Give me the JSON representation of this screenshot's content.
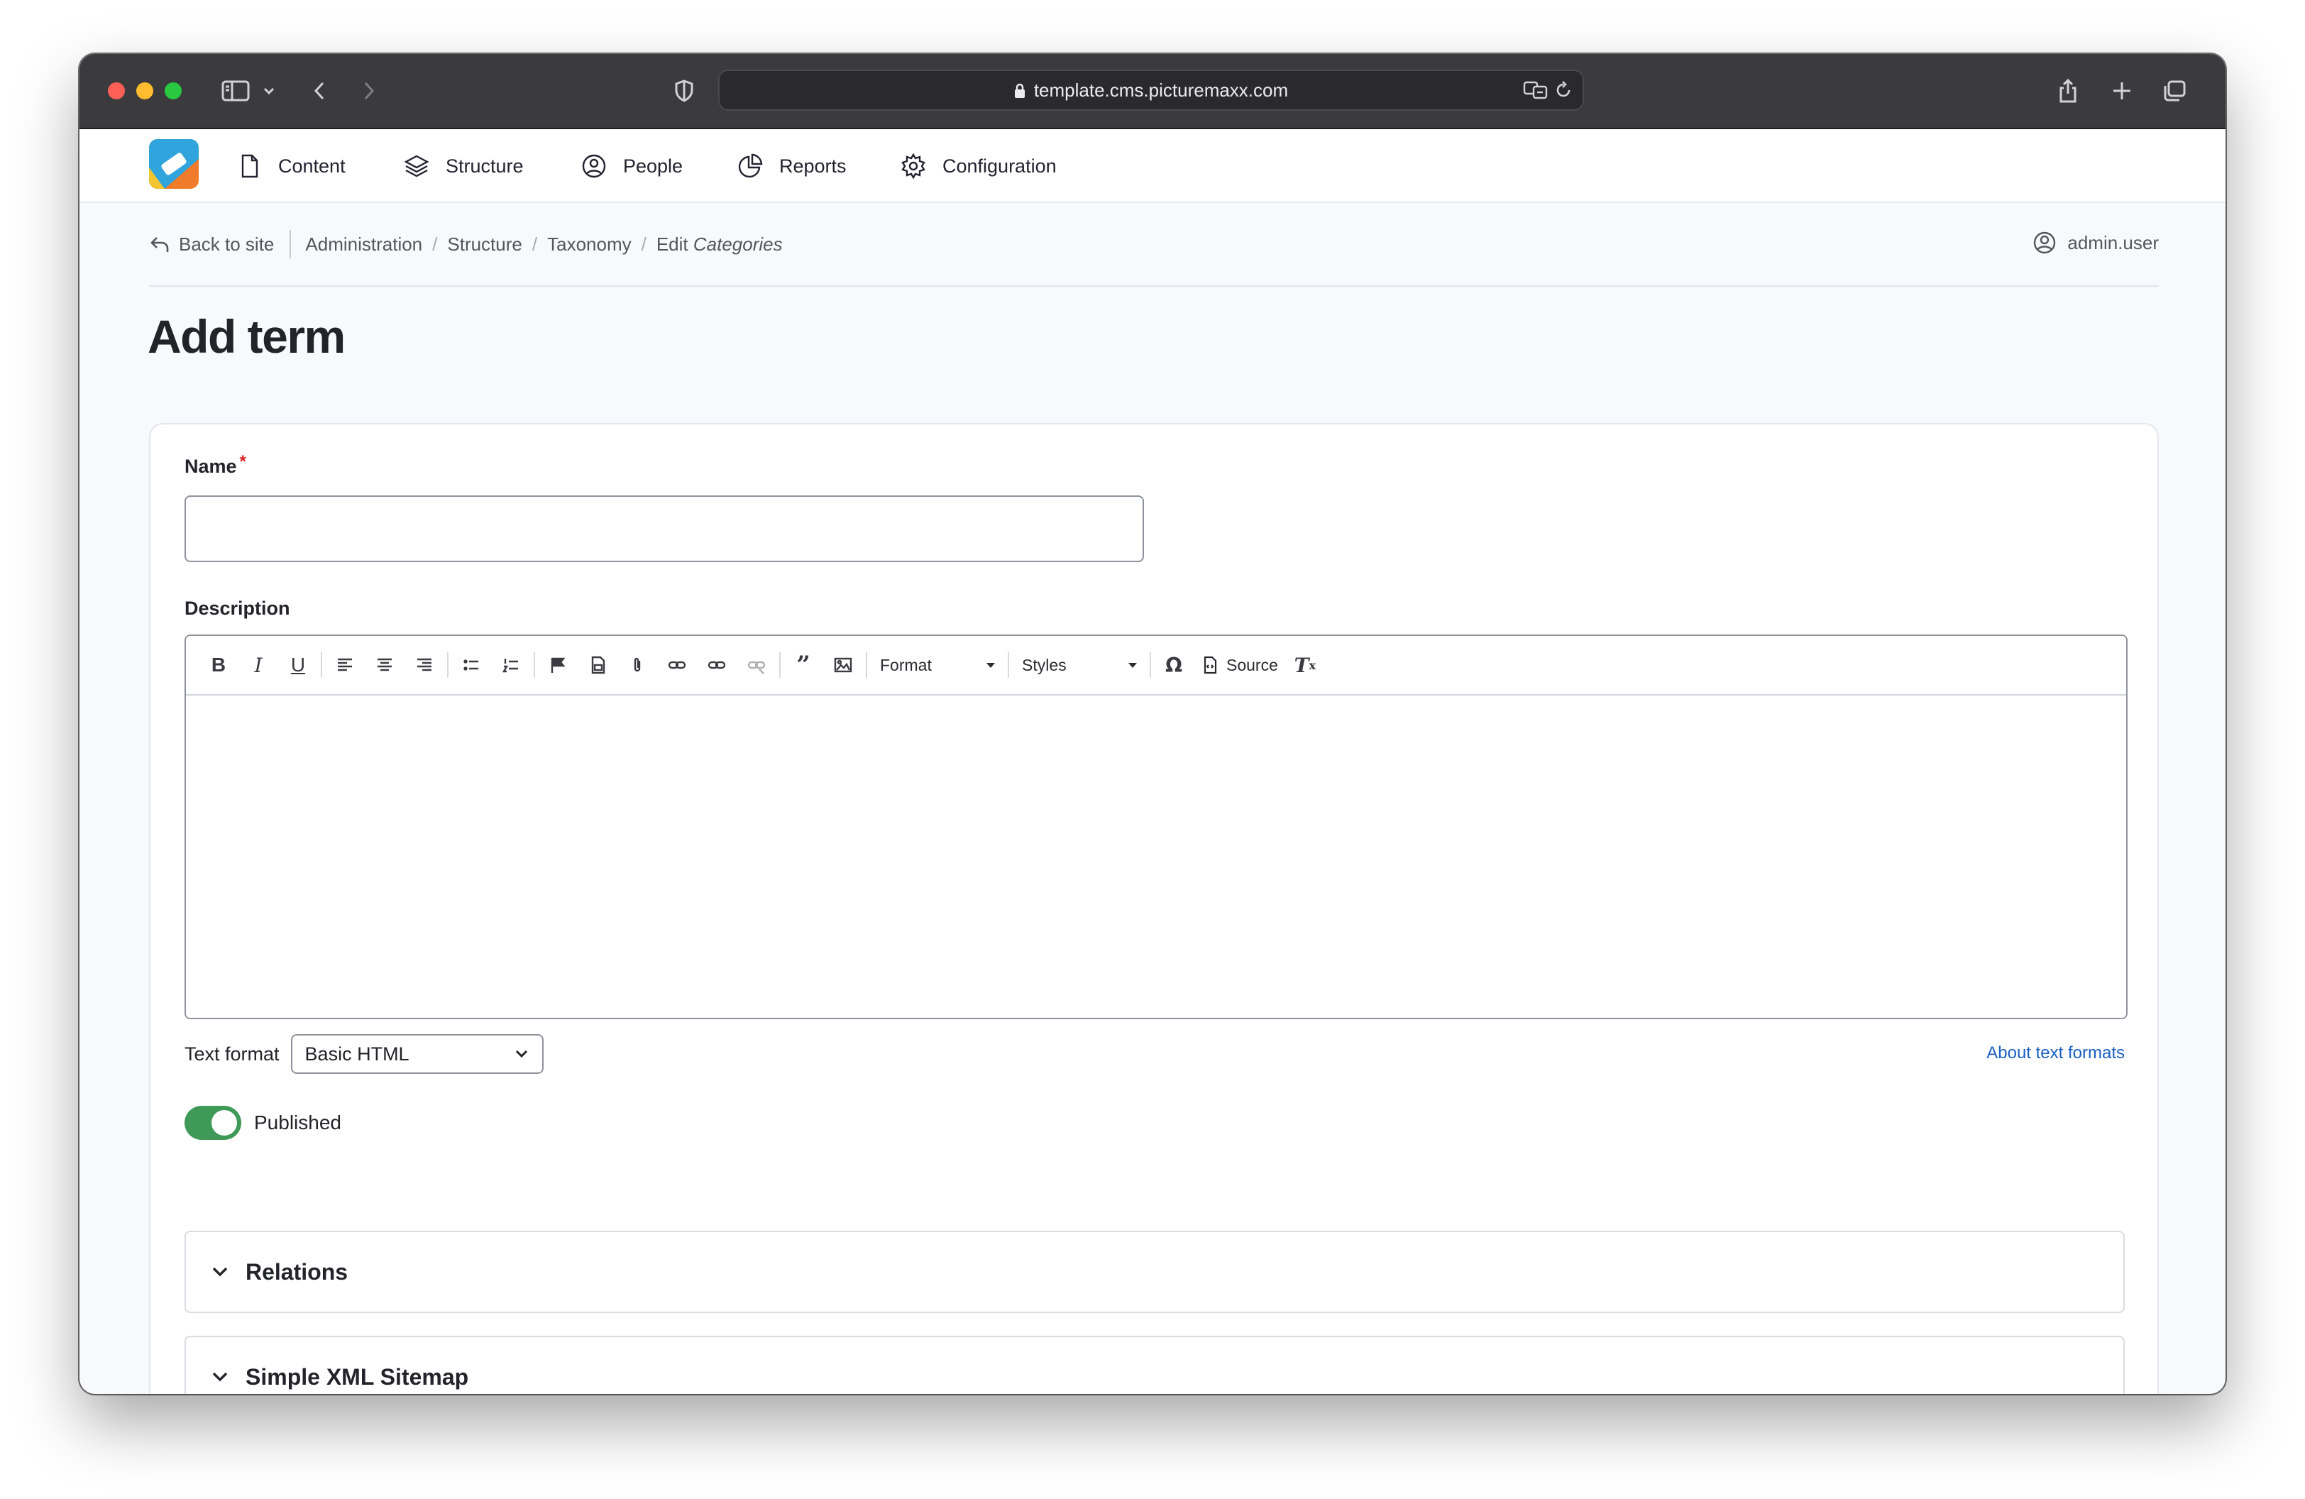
{
  "browser": {
    "url": "template.cms.picturemaxx.com"
  },
  "admin_nav": {
    "items": [
      {
        "label": "Content",
        "icon": "file-icon"
      },
      {
        "label": "Structure",
        "icon": "layers-icon"
      },
      {
        "label": "People",
        "icon": "user-circle-icon"
      },
      {
        "label": "Reports",
        "icon": "pie-chart-icon"
      },
      {
        "label": "Configuration",
        "icon": "gear-icon"
      }
    ]
  },
  "breadcrumb": {
    "back": "Back to site",
    "items": [
      "Administration",
      "Structure",
      "Taxonomy"
    ],
    "last_prefix": "Edit",
    "last_em": "Categories"
  },
  "user": {
    "name": "admin.user"
  },
  "page": {
    "title": "Add term"
  },
  "form": {
    "name_label": "Name",
    "required_mark": "*",
    "name_value": "",
    "description_label": "Description",
    "editor": {
      "format_label": "Format",
      "styles_label": "Styles",
      "source_label": "Source"
    },
    "text_format": {
      "label": "Text format",
      "selected": "Basic HTML",
      "about_link": "About text formats"
    },
    "published": {
      "label": "Published",
      "on": true
    },
    "sections": [
      {
        "label": "Relations"
      },
      {
        "label": "Simple XML Sitemap"
      }
    ]
  },
  "colors": {
    "accent_link": "#1a5fc4",
    "toggle_on": "#3e9a56",
    "required": "#d72222"
  }
}
